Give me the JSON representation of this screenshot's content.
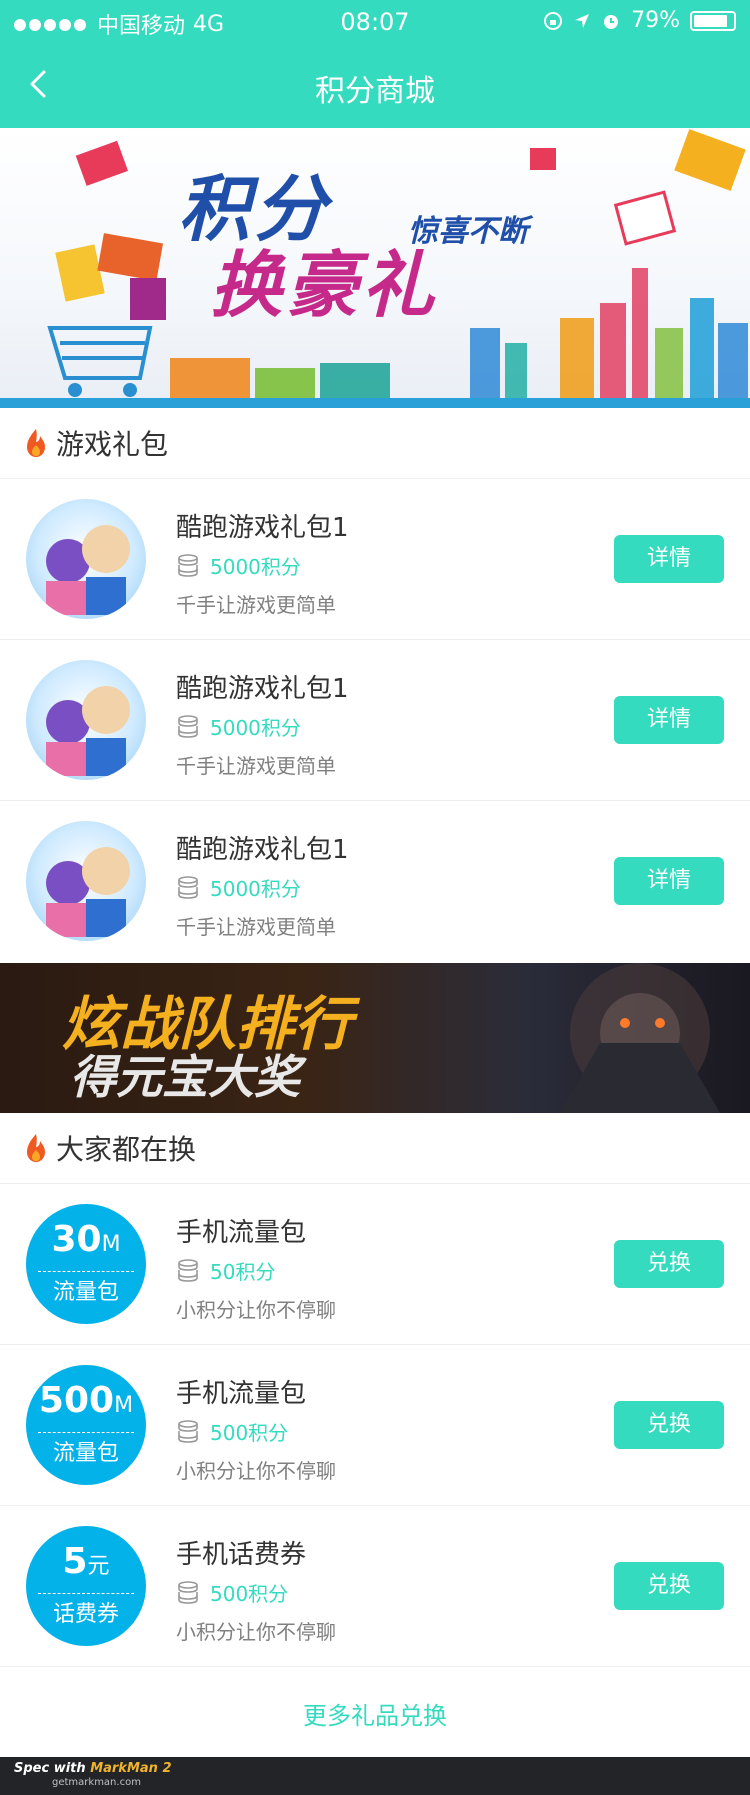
{
  "status_bar": {
    "carrier": "中国移动",
    "network": "4G",
    "time": "08:07",
    "battery": "79%"
  },
  "nav": {
    "title": "积分商城"
  },
  "banner1": {
    "line1": "积分",
    "line2": "换豪礼",
    "slogan": "惊喜不断"
  },
  "section1": {
    "title": "游戏礼包"
  },
  "game_items": [
    {
      "name": "酷跑游戏礼包1",
      "points": "5000积分",
      "desc": "千手让游戏更简单",
      "button": "详情"
    },
    {
      "name": "酷跑游戏礼包1",
      "points": "5000积分",
      "desc": "千手让游戏更简单",
      "button": "详情"
    },
    {
      "name": "酷跑游戏礼包1",
      "points": "5000积分",
      "desc": "千手让游戏更简单",
      "button": "详情"
    }
  ],
  "banner2": {
    "line1": "炫战队排行",
    "line2": "得元宝大奖"
  },
  "section2": {
    "title": "大家都在换"
  },
  "exchange_items": [
    {
      "badge_value": "30",
      "badge_unit": "M",
      "badge_label": "流量包",
      "name": "手机流量包",
      "points": "50积分",
      "desc": "小积分让你不停聊",
      "button": "兑换"
    },
    {
      "badge_value": "500",
      "badge_unit": "M",
      "badge_label": "流量包",
      "name": "手机流量包",
      "points": "500积分",
      "desc": "小积分让你不停聊",
      "button": "兑换"
    },
    {
      "badge_value": "5",
      "badge_unit": "元",
      "badge_label": "话费券",
      "name": "手机话费券",
      "points": "500积分",
      "desc": "小积分让你不停聊",
      "button": "兑换"
    }
  ],
  "more_link": "更多礼品兑换",
  "footer": {
    "brand_prefix": "Spec with ",
    "brand": "MarkMan 2",
    "url": "getmarkman.com"
  },
  "colors": {
    "accent": "#34dbbf",
    "badge": "#04b2ea",
    "text": "#333333",
    "secondary": "#808080"
  }
}
